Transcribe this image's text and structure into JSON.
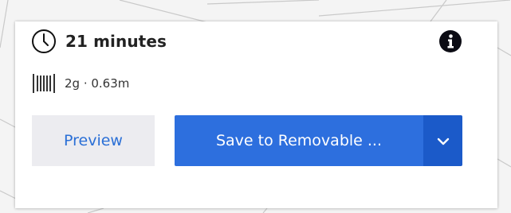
{
  "print_info": {
    "time_icon": "clock-icon",
    "time_label": "21 minutes",
    "info_icon": "info-icon",
    "material_icon": "spool-icon",
    "material_label": "2g · 0.63m"
  },
  "actions": {
    "preview_label": "Preview",
    "save_label": "Save to Removable ...",
    "dropdown_icon": "chevron-down-icon",
    "colors": {
      "primary": "#2d6fde",
      "primary_dark": "#1b5ac9",
      "secondary_bg": "#ececf0",
      "secondary_text": "#2a6fd6"
    }
  }
}
